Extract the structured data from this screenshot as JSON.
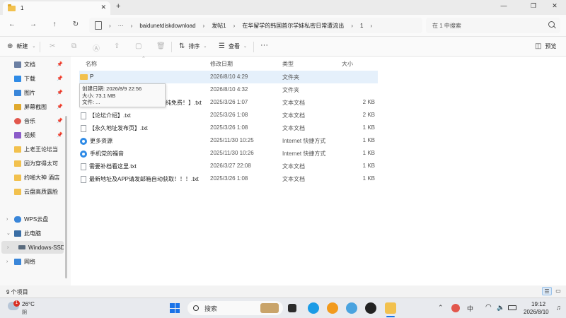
{
  "window": {
    "tab_title": "1",
    "close": "✕",
    "new_tab": "+",
    "minimize": "—",
    "maximize": "❐",
    "close_window": "✕"
  },
  "nav": {
    "back": "←",
    "forward": "→",
    "up": "↑",
    "refresh": "↻",
    "breadcrumb": [
      "baidunetdiskdownload",
      "发帖1",
      "在华留学的韩国首尔学妹私密日常遭流出",
      "1"
    ],
    "ellipsis": "···",
    "search_placeholder": "在 1 中搜索"
  },
  "commands": {
    "new": "新建",
    "sort": "排序",
    "view": "查看",
    "more": "···",
    "preview": "预览"
  },
  "sidebar": {
    "quick": [
      {
        "label": "文档",
        "color": "#6b7fa3"
      },
      {
        "label": "下载",
        "color": "#2f8be6"
      },
      {
        "label": "图片",
        "color": "#3a86d9"
      },
      {
        "label": "屏幕截图",
        "color": "#e0a92e"
      },
      {
        "label": "音乐",
        "color": "#e2574c"
      },
      {
        "label": "视频",
        "color": "#8b5cc9"
      },
      {
        "label": "上老王论坛当",
        "color": "#f2c14e"
      },
      {
        "label": "因为穿得太可",
        "color": "#f2c14e"
      },
      {
        "label": "约啪大神 酒店",
        "color": "#f2c14e"
      },
      {
        "label": "云盘高质露脸",
        "color": "#f2c14e"
      }
    ],
    "tree": [
      {
        "label": "WPS云盘",
        "color": "#3a86d9"
      },
      {
        "label": "此电脑",
        "color": "#3a6ea5"
      },
      {
        "label": "Windows-SSD",
        "color": "#5a6b7d"
      },
      {
        "label": "网络",
        "color": "#3a86d9"
      }
    ]
  },
  "columns": {
    "name": "名称",
    "modified": "修改日期",
    "type": "类型",
    "size": "大小"
  },
  "files": [
    {
      "name": "P",
      "modified": "2026/8/10 4:29",
      "type": "文件夹",
      "size": "",
      "icon": "folder-icon"
    },
    {
      "name": "",
      "modified": "2026/8/10 4:32",
      "type": "文件夹",
      "size": "",
      "icon": "folder-icon"
    },
    {
      "name": "纯免费！】.txt",
      "modified": "2025/3/26 1:07",
      "type": "文本文档",
      "size": "2 KB",
      "icon": "text-file-icon"
    },
    {
      "name": "【论坛介绍】.txt",
      "modified": "2025/3/26 1:08",
      "type": "文本文档",
      "size": "2 KB",
      "icon": "text-file-icon"
    },
    {
      "name": "【永久地址发布页】.txt",
      "modified": "2025/3/26 1:08",
      "type": "文本文档",
      "size": "1 KB",
      "icon": "text-file-icon"
    },
    {
      "name": "更多资源",
      "modified": "2025/11/30 10:25",
      "type": "Internet 快捷方式",
      "size": "1 KB",
      "icon": "internet-shortcut-icon"
    },
    {
      "name": "手机党的福音",
      "modified": "2025/11/30 10:26",
      "type": "Internet 快捷方式",
      "size": "1 KB",
      "icon": "internet-shortcut-icon"
    },
    {
      "name": "需要补档看这里.txt",
      "modified": "2026/3/27 22:08",
      "type": "文本文档",
      "size": "1 KB",
      "icon": "text-file-icon"
    },
    {
      "name": "最新地址及APP请发邮箱自动获取！！！.txt",
      "modified": "2025/3/26 1:08",
      "type": "文本文档",
      "size": "1 KB",
      "icon": "text-file-icon"
    }
  ],
  "tooltip": {
    "created": "创建日期: 2026/8/9 22:56",
    "size": "大小: 73.1 MB",
    "files": "文件: ..."
  },
  "status": {
    "count": "9 个项目"
  },
  "taskbar": {
    "weather_temp": "26°C",
    "weather_desc": "阴",
    "badge": "1",
    "search": "搜索",
    "time": "19:12",
    "date": "2026/8/10",
    "ime": "中"
  }
}
